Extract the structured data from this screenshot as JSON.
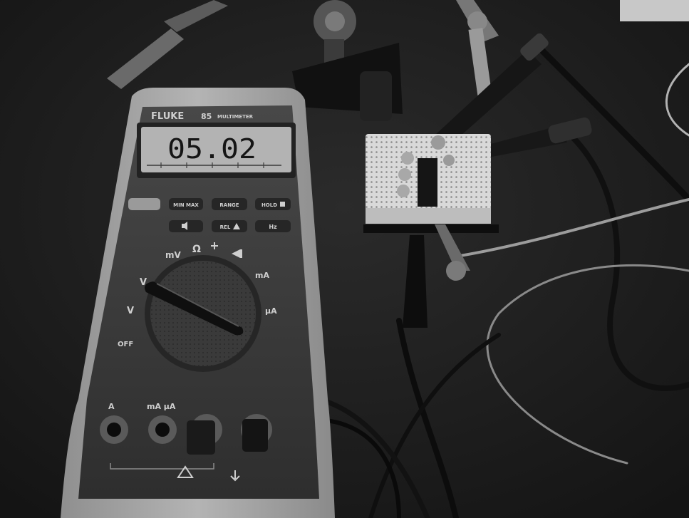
{
  "meter": {
    "brand": "FLUKE",
    "model": "85",
    "model_suffix": "MULTIMETER",
    "display_reading": "05.02",
    "buttons": {
      "min_max": "MIN MAX",
      "range": "RANGE",
      "hold": "HOLD",
      "rel": "REL",
      "hz": "Hz"
    },
    "dial_labels": {
      "off": "OFF",
      "volts_ac": "V",
      "volts_dc": "V",
      "millivolts": "mV",
      "ohms": "Ω",
      "milliamps": "mA",
      "microamps": "μA"
    },
    "jacks": {
      "amps": "A",
      "milliamps_microamps": "mA μA"
    }
  },
  "colors": {
    "background": "#1d1d1d",
    "meter_body": "#a9a9a9",
    "meter_face": "#3b3b3b",
    "lcd": "#b3b3b3",
    "board": "#d6d6d6"
  }
}
